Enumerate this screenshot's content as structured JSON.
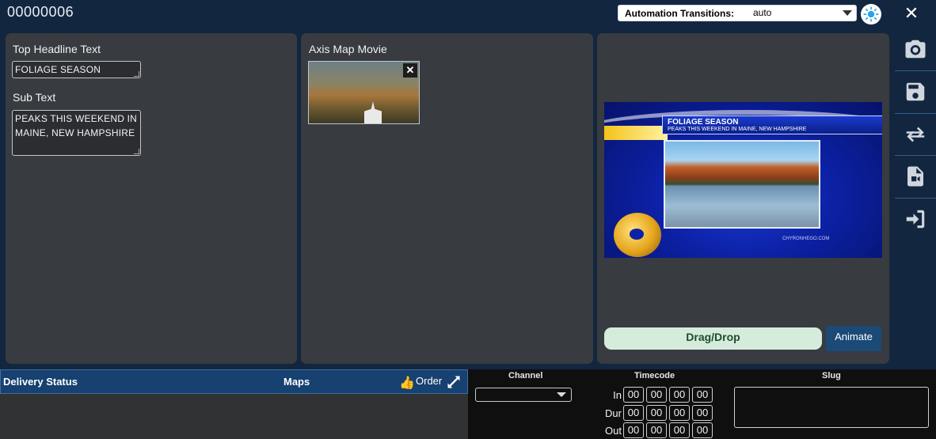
{
  "window": {
    "doc_id": "00000006"
  },
  "automation": {
    "label": "Automation Transitions:",
    "value": "auto"
  },
  "editor": {
    "headline_label": "Top Headline Text",
    "headline_value": "FOLIAGE SEASON",
    "subtext_label": "Sub Text",
    "subtext_value": "PEAKS THIS WEEKEND IN MAINE, NEW HAMPSHIRE"
  },
  "media": {
    "label": "Axis Map Movie",
    "close_glyph": "✕"
  },
  "preview": {
    "headline": "FOLIAGE SEASON",
    "subline": "PEAKS THIS WEEKEND IN MAINE, NEW HAMPSHIRE",
    "url": "CHYRONHEGO.COM",
    "drag_drop_label": "Drag/Drop",
    "animate_label": "Animate"
  },
  "toolbar": {
    "items": [
      {
        "icon": "camera-icon"
      },
      {
        "icon": "save-icon"
      },
      {
        "icon": "swap-icon"
      },
      {
        "icon": "video-file-icon"
      },
      {
        "icon": "sign-in-icon"
      }
    ]
  },
  "delivery": {
    "status_label": "Delivery Status",
    "maps_label": "Maps",
    "order_label": "Order"
  },
  "playout": {
    "channel_label": "Channel",
    "timecode_label": "Timecode",
    "slug_label": "Slug",
    "in_label": "In",
    "dur_label": "Dur",
    "out_label": "Out",
    "tc_value": "00"
  },
  "colors": {
    "accent": "#1b4a77",
    "background": "#13263f",
    "panel": "#383b40",
    "dragdrop": "#d5ecdd"
  }
}
